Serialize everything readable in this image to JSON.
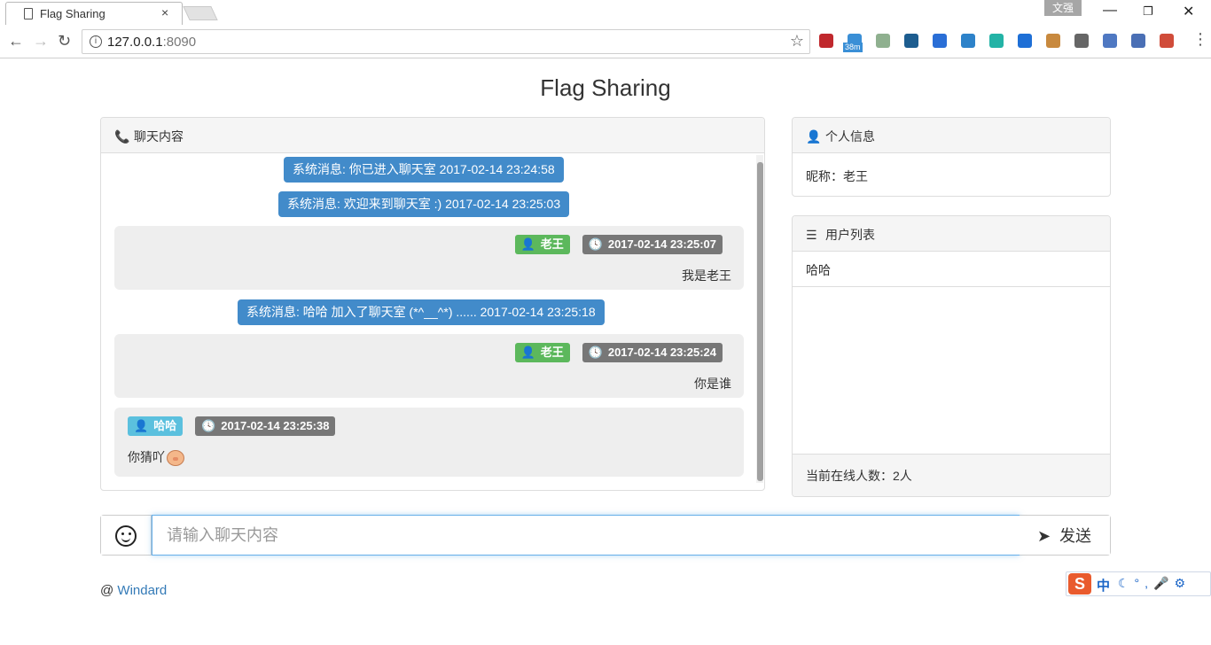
{
  "browser": {
    "tab_title": "Flag Sharing",
    "tab_close": "×",
    "window_label": "文强",
    "url_host": "127.0.0.1",
    "url_port": ":8090",
    "extensions": [
      {
        "name": "adblock-icon",
        "color": "#c0282d"
      },
      {
        "name": "timer-extension-icon",
        "color": "#3a8fd6"
      },
      {
        "name": "circle-extension-icon",
        "color": "#8fb08f"
      },
      {
        "name": "m-extension-icon",
        "color": "#1d5d8f"
      },
      {
        "name": "eyedropper-extension-icon",
        "color": "#2a6ed6"
      },
      {
        "name": "y-extension-icon",
        "color": "#2d82c9"
      },
      {
        "name": "m-circle-extension-icon",
        "color": "#23b3a6"
      },
      {
        "name": "w-extension-icon",
        "color": "#1e6fd6"
      },
      {
        "name": "cookie-extension-icon",
        "color": "#c8893e"
      },
      {
        "name": "link-extension-icon",
        "color": "#666666"
      },
      {
        "name": "globe-extension-icon",
        "color": "#4f78c2"
      },
      {
        "name": "translate-extension-icon",
        "color": "#4a6fb5"
      },
      {
        "name": "s-extension-icon",
        "color": "#d04c3a"
      }
    ],
    "timer_badge": "38m"
  },
  "page": {
    "brand": "Flag Sharing"
  },
  "chat": {
    "heading": "聊天内容",
    "system_messages": [
      "系统消息: 你已进入聊天室  2017-02-14 23:24:58",
      "系统消息: 欢迎来到聊天室 :)  2017-02-14 23:25:03",
      "系统消息: 哈哈 加入了聊天室 (*^__^*) ......  2017-02-14 23:25:18"
    ],
    "messages": [
      {
        "user": "老王",
        "time": "2017-02-14 23:25:07",
        "text": "我是老王",
        "align": "right"
      },
      {
        "user": "老王",
        "time": "2017-02-14 23:25:24",
        "text": "你是谁",
        "align": "right"
      },
      {
        "user": "哈哈",
        "time": "2017-02-14 23:25:38",
        "text": "你猜吖",
        "align": "left"
      }
    ]
  },
  "profile": {
    "heading": "个人信息",
    "nickname": "昵称：老王"
  },
  "users": {
    "heading": "用户列表",
    "list": [
      "哈哈"
    ],
    "online_count": "当前在线人数：2人"
  },
  "composer": {
    "placeholder": "请输入聊天内容",
    "send_label": "发送"
  },
  "footer": {
    "prefix": "@",
    "link": "Windard"
  },
  "ime": {
    "logo": "S",
    "mode": "中"
  },
  "colors": {
    "primary": "#428bca",
    "success": "#5cb85c",
    "info": "#5bc0de",
    "default": "#777777"
  }
}
